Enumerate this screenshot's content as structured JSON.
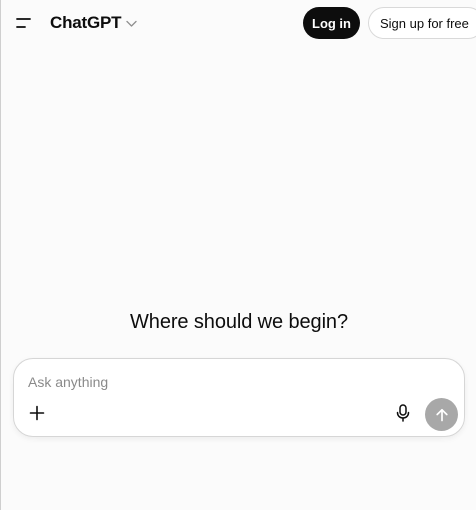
{
  "header": {
    "model_name": "ChatGPT",
    "menu_icon": "sidebar-menu-icon",
    "chevron_icon": "chevron-down-icon",
    "login_label": "Log in",
    "signup_label": "Sign up for free"
  },
  "main": {
    "heading": "Where should we begin?"
  },
  "composer": {
    "placeholder": "Ask anything",
    "value": "",
    "plus_icon": "plus-icon",
    "mic_icon": "microphone-icon",
    "send_icon": "arrow-up-icon"
  },
  "colors": {
    "background": "#fbfbfb",
    "primary_button": "#0d0d0d",
    "send_button_disabled": "#a8a8a8"
  }
}
